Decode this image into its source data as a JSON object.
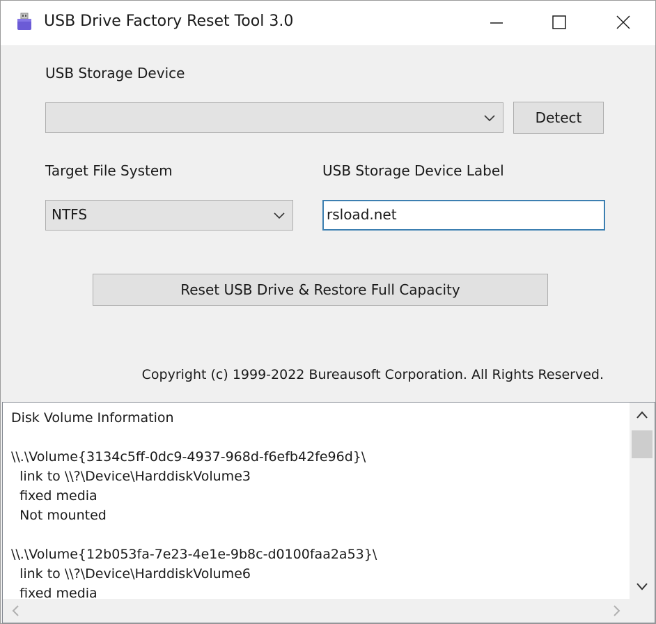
{
  "window": {
    "title": "USB Drive Factory Reset Tool 3.0",
    "icon": "usb-drive-icon",
    "controls": {
      "minimize_icon": "minimize-icon",
      "maximize_icon": "maximize-icon",
      "close_icon": "close-icon"
    }
  },
  "device": {
    "label": "USB Storage Device",
    "selected": "",
    "detect_button": "Detect"
  },
  "filesystem": {
    "label": "Target File System",
    "selected": "NTFS"
  },
  "volume_label": {
    "label": "USB Storage Device Label",
    "value": "rsload.net"
  },
  "reset_button": "Reset USB Drive & Restore Full Capacity",
  "copyright": "Copyright (c) 1999-2022 Bureausoft Corporation. All Rights Reserved.",
  "info": {
    "lines": [
      "Disk Volume Information",
      "",
      "\\\\.\\Volume{3134c5ff-0dc9-4937-968d-f6efb42fe96d}\\",
      "  link to \\\\?\\Device\\HarddiskVolume3",
      "  fixed media",
      "  Not mounted",
      "",
      "\\\\.\\Volume{12b053fa-7e23-4e1e-9b8c-d0100faa2a53}\\",
      "  link to \\\\?\\Device\\HarddiskVolume6",
      "  fixed media"
    ]
  },
  "colors": {
    "window_bg": "#f0f0f0",
    "titlebar_bg": "#ffffff",
    "textbox_focus_border": "#3c7fb1",
    "icon_purple": "#6b5bd6"
  }
}
